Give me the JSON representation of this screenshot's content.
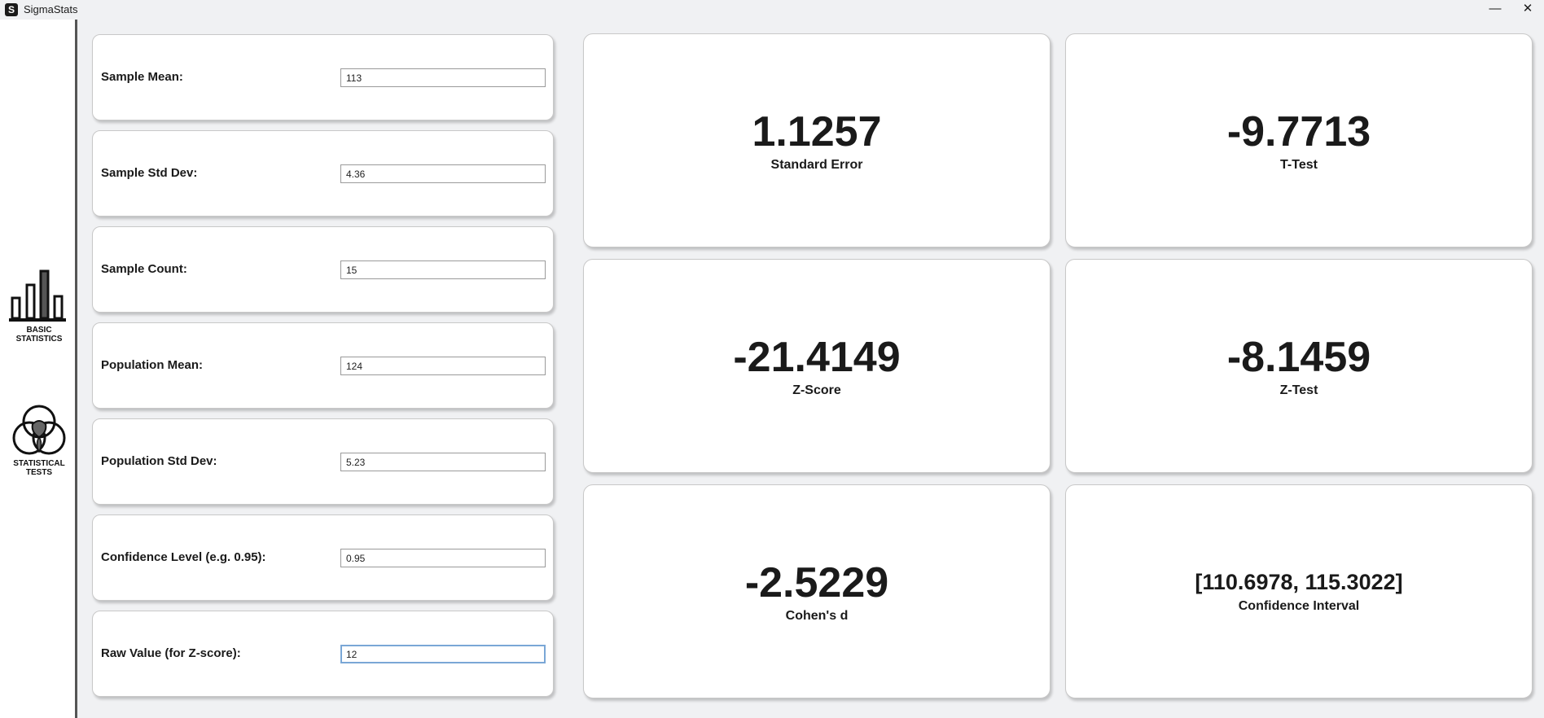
{
  "window": {
    "title": "SigmaStats",
    "app_icon_glyph": "S",
    "minimize_glyph": "—",
    "close_glyph": "✕"
  },
  "sidebar": {
    "items": [
      {
        "label_line1": "BASIC",
        "label_line2": "STATISTICS",
        "icon": "bar-chart-icon",
        "active": true
      },
      {
        "label_line1": "STATISTICAL",
        "label_line2": "TESTS",
        "icon": "venn-diagram-icon",
        "active": false
      }
    ]
  },
  "inputs": [
    {
      "label": "Sample Mean:",
      "value": "113"
    },
    {
      "label": "Sample Std Dev:",
      "value": "4.36"
    },
    {
      "label": "Sample Count:",
      "value": "15"
    },
    {
      "label": "Population Mean:",
      "value": "124"
    },
    {
      "label": "Population Std Dev:",
      "value": "5.23"
    },
    {
      "label": "Confidence Level (e.g. 0.95):",
      "value": "0.95"
    },
    {
      "label": "Raw Value (for Z-score):",
      "value": "12",
      "focused": true
    }
  ],
  "results": {
    "standard_error": {
      "value": "1.1257",
      "label": "Standard Error"
    },
    "t_test": {
      "value": "-9.7713",
      "label": "T-Test"
    },
    "z_score": {
      "value": "-21.4149",
      "label": "Z-Score"
    },
    "z_test": {
      "value": "-8.1459",
      "label": "Z-Test"
    },
    "cohens_d": {
      "value": "-2.5229",
      "label": "Cohen's d"
    },
    "confidence_interval": {
      "value": "[110.6978, 115.3022]",
      "label": "Confidence Interval"
    }
  },
  "colors": {
    "background": "#f0f1f3",
    "card": "#ffffff",
    "text": "#1a1a1a",
    "focus_border": "#7aa7d6",
    "sidebar_border": "#555555"
  }
}
